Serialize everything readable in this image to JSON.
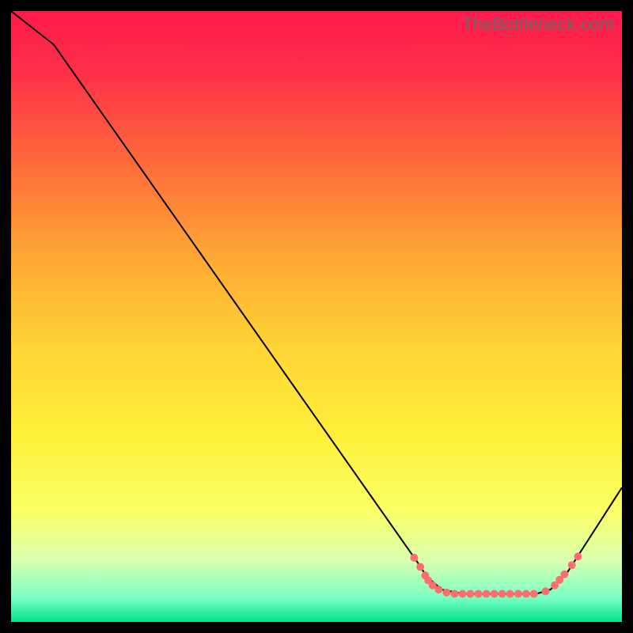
{
  "watermark": "TheBottleneck.com",
  "chart_data": {
    "type": "line",
    "title": "",
    "xlabel": "",
    "ylabel": "",
    "xlim": [
      0,
      100
    ],
    "ylim": [
      0,
      100
    ],
    "grid": false,
    "background_gradient": {
      "stops": [
        {
          "offset": 0.0,
          "color": "#ff1a4d"
        },
        {
          "offset": 0.1,
          "color": "#ff2f49"
        },
        {
          "offset": 0.25,
          "color": "#ff6b3a"
        },
        {
          "offset": 0.4,
          "color": "#ffa733"
        },
        {
          "offset": 0.55,
          "color": "#ffd433"
        },
        {
          "offset": 0.7,
          "color": "#fff13a"
        },
        {
          "offset": 0.82,
          "color": "#f9ff66"
        },
        {
          "offset": 0.9,
          "color": "#d9ffb0"
        },
        {
          "offset": 0.96,
          "color": "#7affc4"
        },
        {
          "offset": 1.0,
          "color": "#00e58a"
        }
      ]
    },
    "series": [
      {
        "name": "curve",
        "color": "#000000",
        "width": 2.0,
        "points": [
          {
            "x": 0.0,
            "y": 100.0
          },
          {
            "x": 7.0,
            "y": 94.5
          },
          {
            "x": 66.5,
            "y": 9.8
          },
          {
            "x": 68.0,
            "y": 7.5
          },
          {
            "x": 70.5,
            "y": 5.3
          },
          {
            "x": 74.0,
            "y": 4.6
          },
          {
            "x": 80.0,
            "y": 4.6
          },
          {
            "x": 86.0,
            "y": 4.6
          },
          {
            "x": 88.3,
            "y": 5.3
          },
          {
            "x": 91.0,
            "y": 8.0
          },
          {
            "x": 100.0,
            "y": 22.0
          }
        ]
      }
    ],
    "dots": {
      "color": "#ff6e6e",
      "radius": 5,
      "points": [
        {
          "x": 66.0,
          "y": 10.5
        },
        {
          "x": 67.0,
          "y": 9.0
        },
        {
          "x": 67.8,
          "y": 7.6
        },
        {
          "x": 68.3,
          "y": 6.8
        },
        {
          "x": 69.0,
          "y": 6.0
        },
        {
          "x": 70.0,
          "y": 5.3
        },
        {
          "x": 71.3,
          "y": 4.8
        },
        {
          "x": 72.6,
          "y": 4.6
        },
        {
          "x": 73.9,
          "y": 4.6
        },
        {
          "x": 75.2,
          "y": 4.6
        },
        {
          "x": 76.5,
          "y": 4.6
        },
        {
          "x": 77.8,
          "y": 4.6
        },
        {
          "x": 79.1,
          "y": 4.6
        },
        {
          "x": 80.4,
          "y": 4.6
        },
        {
          "x": 81.7,
          "y": 4.6
        },
        {
          "x": 83.0,
          "y": 4.6
        },
        {
          "x": 84.3,
          "y": 4.6
        },
        {
          "x": 85.6,
          "y": 4.6
        },
        {
          "x": 87.5,
          "y": 5.0
        },
        {
          "x": 89.0,
          "y": 6.0
        },
        {
          "x": 89.8,
          "y": 6.9
        },
        {
          "x": 90.6,
          "y": 7.8
        },
        {
          "x": 91.8,
          "y": 9.3
        },
        {
          "x": 92.8,
          "y": 10.7
        }
      ]
    }
  }
}
